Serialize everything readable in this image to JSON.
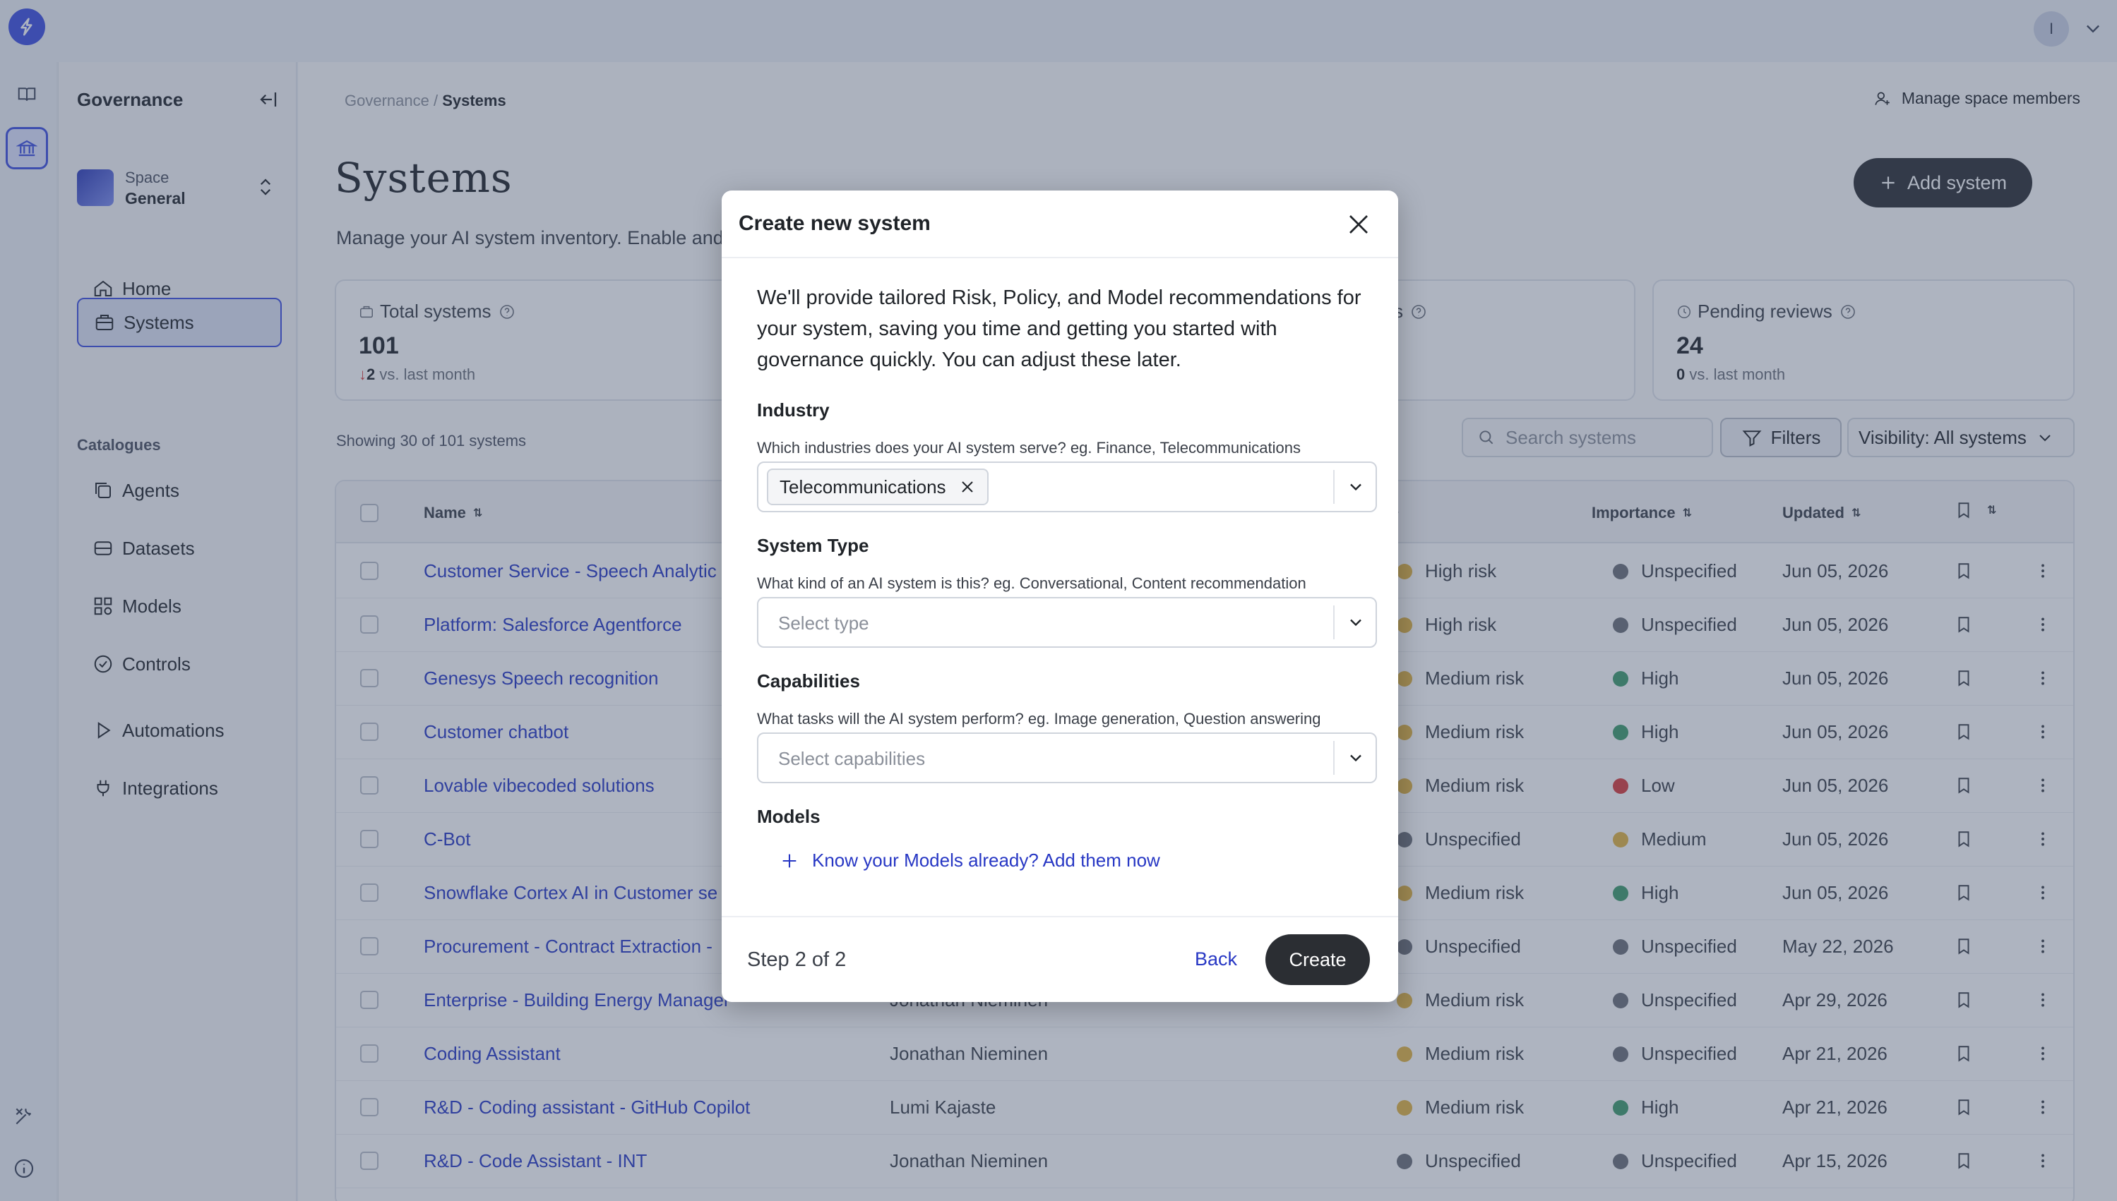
{
  "topbar": {
    "avatar_initial": "I"
  },
  "sidebar": {
    "title": "Governance",
    "space_label": "Space",
    "space_name": "General",
    "nav": [
      "Home",
      "Systems"
    ],
    "section": "Catalogues",
    "catalogue": [
      "Agents",
      "Datasets",
      "Models",
      "Controls",
      "Automations",
      "Integrations"
    ]
  },
  "header": {
    "crumb_parent": "Governance",
    "crumb_sep": " / ",
    "crumb_current": "Systems",
    "manage": "Manage space members",
    "title": "Systems",
    "add": "Add system",
    "subtitle": "Manage your AI system inventory. Enable and"
  },
  "stats": {
    "total_label": "Total systems",
    "total_value": "101",
    "total_delta": "2",
    "total_delta_suffix": "vs. last month",
    "mid_label_tail": "s",
    "pending_label": "Pending reviews",
    "pending_value": "24",
    "pending_delta": "0",
    "pending_delta_suffix": "vs. last month"
  },
  "toolbar": {
    "showing": "Showing 30 of 101 systems",
    "search_placeholder": "Search systems",
    "filters": "Filters",
    "visibility": "Visibility: All systems"
  },
  "table": {
    "headers": {
      "name": "Name",
      "importance": "Importance",
      "updated": "Updated"
    },
    "rows": [
      {
        "name": "Customer Service - Speech Analytic",
        "owner": "",
        "risk": "High risk",
        "importance": "Unspecified",
        "updated": "Jun 05, 2026"
      },
      {
        "name": "Platform: Salesforce Agentforce",
        "owner": "",
        "risk": "High risk",
        "importance": "Unspecified",
        "updated": "Jun 05, 2026"
      },
      {
        "name": "Genesys Speech recognition",
        "owner": "",
        "risk": "Medium risk",
        "importance": "High",
        "updated": "Jun 05, 2026"
      },
      {
        "name": "Customer chatbot",
        "owner": "",
        "risk": "Medium risk",
        "importance": "High",
        "updated": "Jun 05, 2026"
      },
      {
        "name": "Lovable vibecoded solutions",
        "owner": "",
        "risk": "Medium risk",
        "importance": "Low",
        "updated": "Jun 05, 2026"
      },
      {
        "name": "C-Bot",
        "owner": "",
        "risk": "Unspecified",
        "importance": "Medium",
        "updated": "Jun 05, 2026"
      },
      {
        "name": "Snowflake Cortex AI in Customer se",
        "owner": "",
        "risk": "Medium risk",
        "importance": "High",
        "updated": "Jun 05, 2026"
      },
      {
        "name": "Procurement - Contract Extraction -",
        "owner": "",
        "risk": "Unspecified",
        "importance": "Unspecified",
        "updated": "May 22, 2026"
      },
      {
        "name": "Enterprise - Building Energy Manager",
        "owner": "Jonathan Nieminen",
        "risk": "Medium risk",
        "importance": "Unspecified",
        "updated": "Apr 29, 2026"
      },
      {
        "name": "Coding Assistant",
        "owner": "Jonathan Nieminen",
        "risk": "Medium risk",
        "importance": "Unspecified",
        "updated": "Apr 21, 2026"
      },
      {
        "name": "R&D - Coding assistant - GitHub Copilot",
        "owner": "Lumi Kajaste",
        "risk": "Medium risk",
        "importance": "High",
        "updated": "Apr 21, 2026"
      },
      {
        "name": "R&D - Code Assistant - INT",
        "owner": "Jonathan Nieminen",
        "risk": "Unspecified",
        "importance": "Unspecified",
        "updated": "Apr 15, 2026"
      }
    ]
  },
  "colors": {
    "accent": "#3d4fe0",
    "link": "#2737c4",
    "high": "#3f9b6b",
    "low": "#d93b3b",
    "medium": "#e2b440",
    "unspecified": "#6b6f77"
  },
  "modal": {
    "title": "Create new system",
    "intro": "We'll provide tailored Risk, Policy, and Model recommendations for your system, saving you time and getting you started with governance quickly. You can adjust these later.",
    "industry_label": "Industry",
    "industry_help": "Which industries does your AI system serve? eg. Finance, Telecommunications",
    "industry_chip": "Telecommunications",
    "type_label": "System Type",
    "type_help": "What kind of an AI system is this? eg. Conversational, Content recommendation",
    "type_placeholder": "Select type",
    "cap_label": "Capabilities",
    "cap_help": "What tasks will the AI system perform? eg. Image generation, Question answering",
    "cap_placeholder": "Select capabilities",
    "models_label": "Models",
    "models_add": "Know your Models already? Add them now",
    "step": "Step 2 of 2",
    "back": "Back",
    "create": "Create"
  }
}
